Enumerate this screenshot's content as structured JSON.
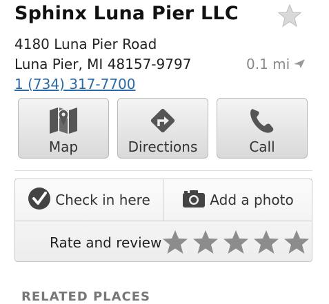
{
  "place": {
    "name": "Sphinx Luna Pier LLC",
    "address_line1": "4180 Luna Pier Road",
    "address_line2": "Luna Pier, MI 48157-9797",
    "distance": "0.1 mi",
    "phone": "1 (734) 317-7700"
  },
  "actions": {
    "map_label": "Map",
    "directions_label": "Directions",
    "call_label": "Call"
  },
  "card": {
    "checkin_label": "Check in here",
    "add_photo_label": "Add a photo",
    "rate_label": "Rate and review"
  },
  "sections": {
    "related_header": "RELATED PLACES"
  },
  "icons": {
    "favorite": "star-outline-icon",
    "distance": "direction-arrow-icon",
    "map": "map-icon",
    "directions": "directions-icon",
    "call": "phone-icon",
    "checkin": "checkmark-icon",
    "photo": "camera-icon",
    "rating": "star-icon"
  },
  "colors": {
    "link": "#2a6aa8",
    "muted": "#888888",
    "icon_dark": "#555555"
  }
}
